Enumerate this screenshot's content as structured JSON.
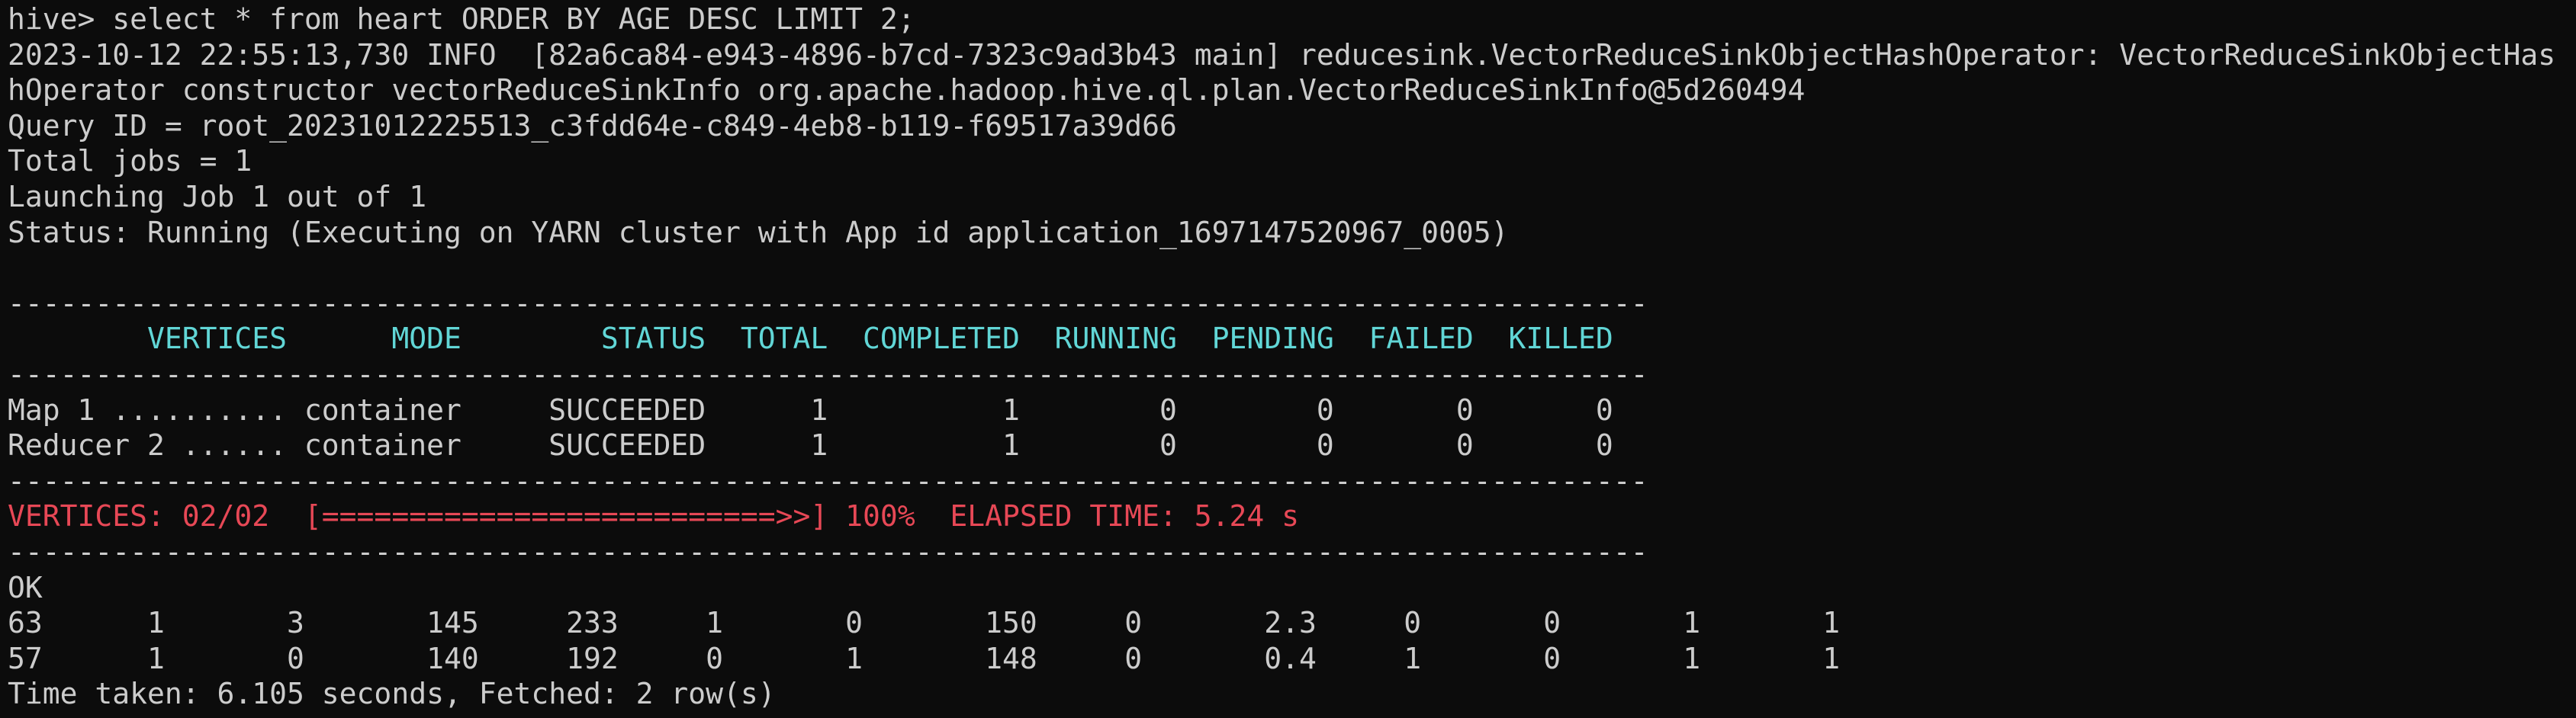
{
  "colors": {
    "background": "#0c0c0c",
    "foreground": "#cccccc",
    "header_cyan": "#61d6d6",
    "progress_red": "#e74856"
  },
  "terminal": {
    "prompt_command": "hive> select * from heart ORDER BY AGE DESC LIMIT 2;",
    "info_line_1": "2023-10-12 22:55:13,730 INFO  [82a6ca84-e943-4896-b7cd-7323c9ad3b43 main] reducesink.VectorReduceSinkObjectHashOperator: VectorReduceSinkObjectHas",
    "info_line_2": "hOperator constructor vectorReduceSinkInfo org.apache.hadoop.hive.ql.plan.VectorReduceSinkInfo@5d260494",
    "query_id": "Query ID = root_20231012225513_c3fdd64e-c849-4eb8-b119-f69517a39d66",
    "total_jobs": "Total jobs = 1",
    "launching": "Launching Job 1 out of 1",
    "status": "Status: Running (Executing on YARN cluster with App id application_1697147520967_0005)",
    "separator": "----------------------------------------------------------------------------------------------",
    "table_header": "        VERTICES      MODE        STATUS  TOTAL  COMPLETED  RUNNING  PENDING  FAILED  KILLED",
    "table_rows": [
      "Map 1 .......... container     SUCCEEDED      1          1        0        0       0       0",
      "Reducer 2 ...... container     SUCCEEDED      1          1        0        0       0       0"
    ],
    "progress_line": "VERTICES: 02/02  [==========================>>] 100%  ELAPSED TIME: 5.24 s",
    "ok": "OK",
    "result_rows": [
      "63      1       3       145     233     1       0       150     0       2.3     0       0       1       1",
      "57      1       0       140     192     0       1       148     0       0.4     1       0       1       1"
    ],
    "time_taken": "Time taken: 6.105 seconds, Fetched: 2 row(s)"
  }
}
